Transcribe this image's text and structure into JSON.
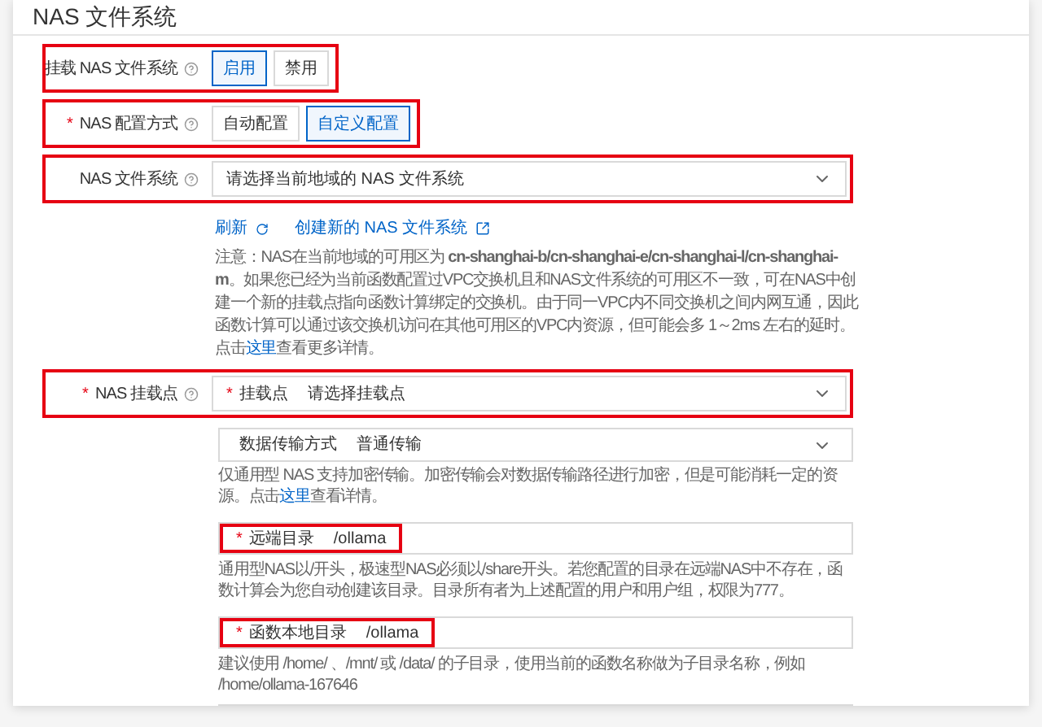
{
  "title": "NAS 文件系统",
  "required_mark": "*",
  "mount_toggle": {
    "label": "挂载 NAS 文件系统",
    "highlighted": true,
    "options": [
      {
        "label": "启用",
        "selected": true
      },
      {
        "label": "禁用",
        "selected": false
      }
    ]
  },
  "config_mode": {
    "label": "NAS 配置方式",
    "required": true,
    "highlighted": true,
    "options": [
      {
        "label": "自动配置",
        "selected": false
      },
      {
        "label": "自定义配置",
        "selected": true
      }
    ]
  },
  "file_system": {
    "label": "NAS 文件系统",
    "highlighted": true,
    "placeholder": "请选择当前地域的 NAS 文件系统"
  },
  "links": [
    {
      "label": "刷新",
      "kind": "refresh"
    },
    {
      "label": "创建新的 NAS 文件系统",
      "kind": "external"
    }
  ],
  "note": {
    "before": "注意：NAS在当前地域的可用区为 **cn-shanghai-b/cn-shanghai-e/cn-shanghai-l/cn-shanghai-m**。如果您已经为当前函数配置过VPC交换机且和NAS文件系统的可用区不一致，可在NAS中创建一个新的挂载点指向函数计算绑定的交换机。由于同一VPC内不同交换机之间内网互通，因此函数计算可以通过该交换机访问在其他可用区的VPC内资源，但可能会多 1～2ms 左右的延时。点击",
    "link": "这里",
    "after": "查看更多详情。"
  },
  "mount_point": {
    "label": "NAS 挂载点",
    "required": true,
    "highlighted": true,
    "inner_label": "挂载点",
    "inner_required": true,
    "placeholder": "请选择挂载点"
  },
  "transfer": {
    "inner_label": "数据传输方式",
    "value": "普通传输",
    "help_before": "仅通用型 NAS 支持加密传输。加密传输会对数据传输路径进行加密，但是可能消耗一定的资源。点击",
    "help_link": "这里",
    "help_after": "查看详情。"
  },
  "remote_dir": {
    "inner_label": "远端目录",
    "required": true,
    "highlighted": true,
    "value": "/ollama",
    "help": "通用型NAS以/开头，极速型NAS必须以/share开头。若您配置的目录在远端NAS中不存在，函数计算会为您自动创建该目录。目录所有者为上述配置的用户和用户组，权限为777。"
  },
  "local_dir": {
    "inner_label": "函数本地目录",
    "required": true,
    "highlighted": true,
    "value": "/ollama",
    "help": "建议使用 /home/ 、/mnt/ 或 /data/ 的子目录，使用当前的函数名称做为子目录名称，例如 /home/ollama-167646"
  }
}
